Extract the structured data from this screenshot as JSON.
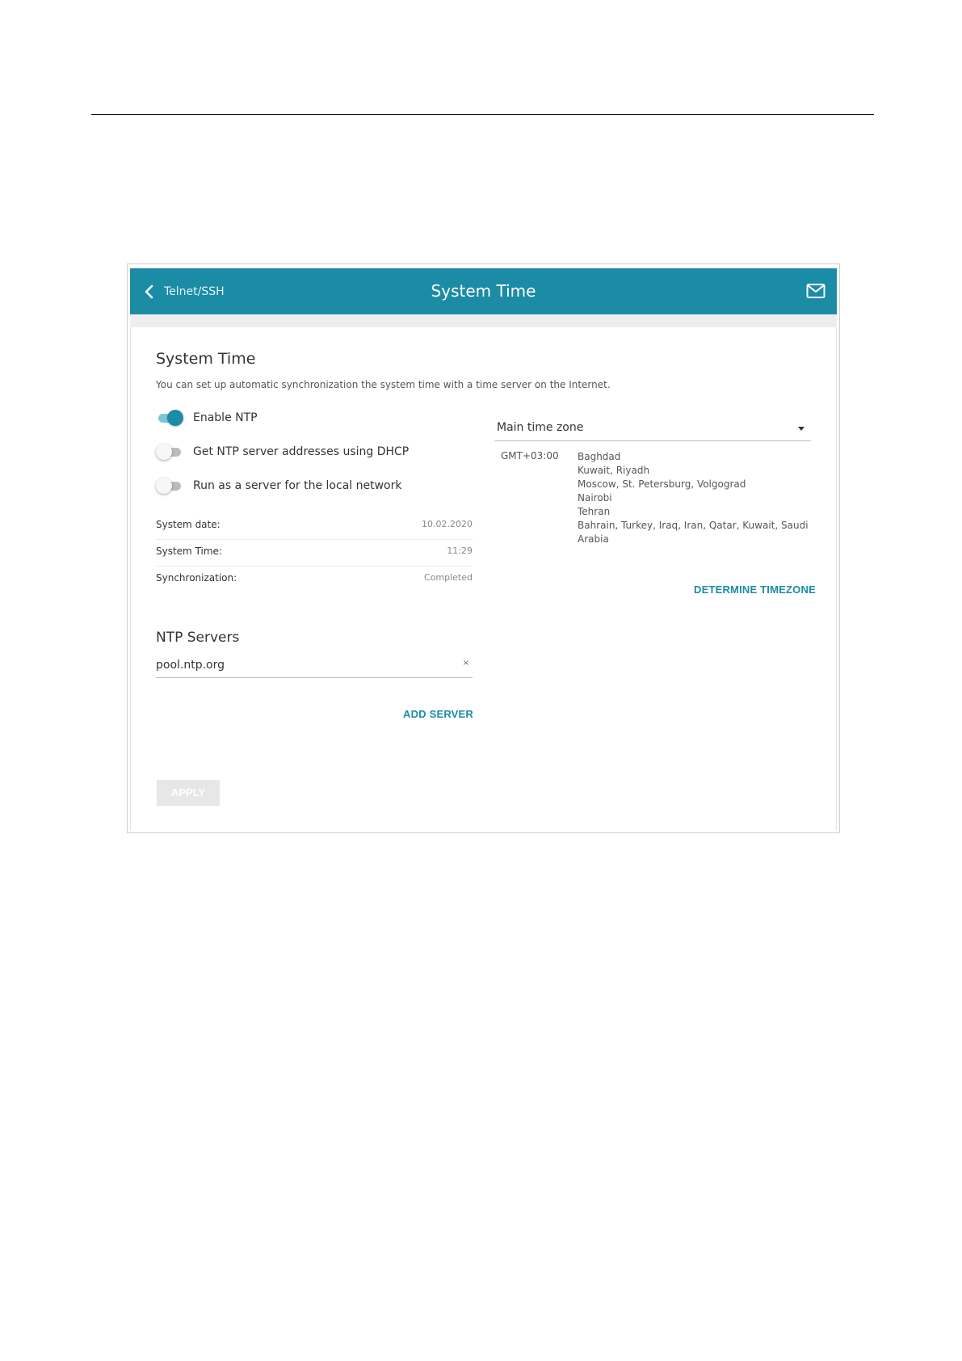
{
  "header": {
    "back_label": "Telnet/SSH",
    "title": "System Time",
    "back_icon": "chevron-left-icon",
    "mail_icon": "mail-icon",
    "color": "#1b8ba6"
  },
  "system_time": {
    "title": "System Time",
    "description": "You can set up automatic synchronization the system time with a time server on the Internet.",
    "toggles": [
      {
        "label": "Enable NTP",
        "on": true
      },
      {
        "label": "Get NTP server addresses using DHCP",
        "on": false
      },
      {
        "label": "Run as a server for the local network",
        "on": false
      }
    ],
    "info": [
      {
        "label": "System date:",
        "value": "10.02.2020"
      },
      {
        "label": "System Time:",
        "value": "11:29"
      },
      {
        "label": "Synchronization:",
        "value": "Completed"
      }
    ]
  },
  "ntp_servers": {
    "title": "NTP Servers",
    "servers": [
      "pool.ntp.org"
    ],
    "clear_symbol": "×",
    "add_label": "ADD SERVER"
  },
  "timezone": {
    "select_value": "Main time zone",
    "gmt": "GMT+03:00",
    "cities": [
      "Baghdad",
      "Kuwait, Riyadh",
      "Moscow, St. Petersburg, Volgograd",
      "Nairobi",
      "Tehran",
      "Bahrain, Turkey, Iraq, Iran, Qatar, Kuwait, Saudi Arabia"
    ],
    "determine_label": "DETERMINE TIMEZONE"
  },
  "apply_label": "APPLY"
}
